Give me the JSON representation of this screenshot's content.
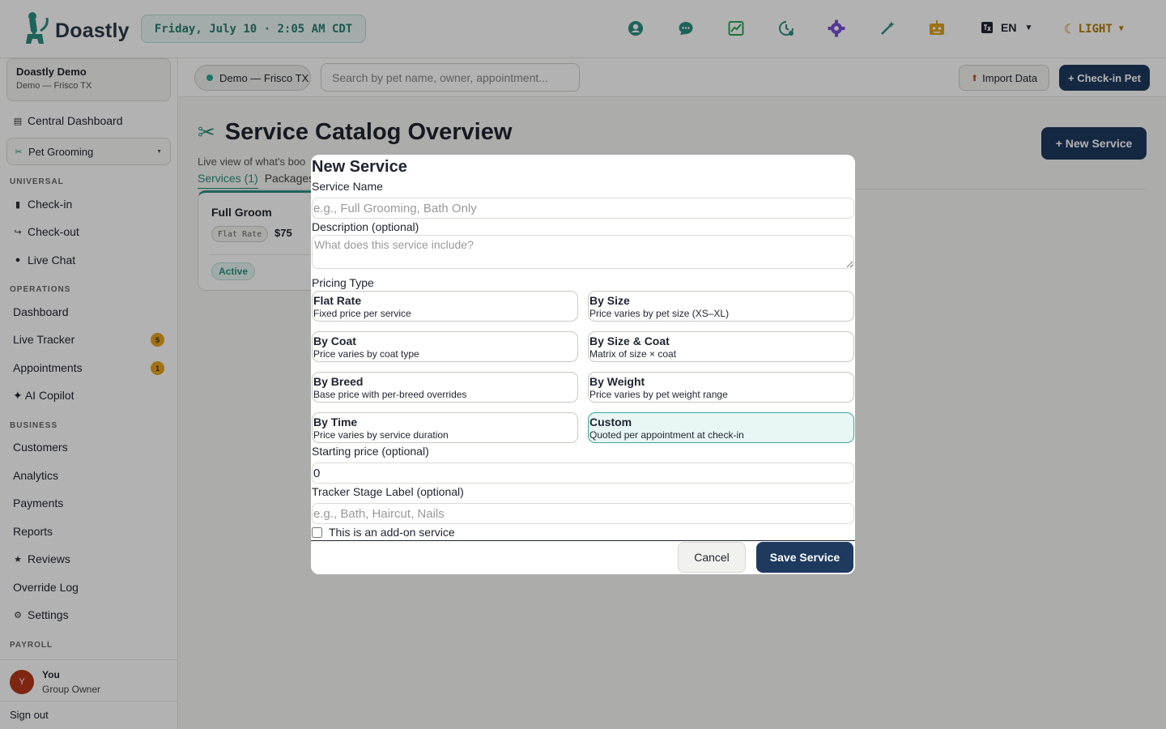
{
  "header": {
    "brand": "Doastly",
    "datetime": "Friday, July 10 · 2:05 AM CDT",
    "icons": [
      "support-icon",
      "chat-icon",
      "analytics-icon",
      "history-icon",
      "settings-icon",
      "magic-icon",
      "robot-icon"
    ],
    "language": "EN",
    "theme": "LIGHT"
  },
  "sidebar": {
    "org_name": "Doastly Demo",
    "org_location": "Demo — Frisco TX",
    "central_dashboard": "Central Dashboard",
    "module": "Pet Grooming",
    "sections": {
      "universal": "UNIVERSAL",
      "operations": "OPERATIONS",
      "business": "BUSINESS",
      "payroll": "PAYROLL"
    },
    "universal_items": [
      "Check-in",
      "Check-out",
      "Live Chat"
    ],
    "operations_items": [
      "Dashboard",
      "Live Tracker",
      "Appointments",
      "✦ AI Copilot"
    ],
    "live_tracker_count": "5",
    "appointments_count": "1",
    "business_items": [
      "Customers",
      "Analytics",
      "Payments",
      "Reports",
      "Reviews",
      "Override Log",
      "Settings"
    ],
    "user_initial": "Y",
    "user_name": "You",
    "user_role": "Group Owner",
    "sign_out": "Sign out"
  },
  "toolbar": {
    "location": "Demo — Frisco TX",
    "search_placeholder": "Search by pet name, owner, appointment...",
    "import_label": "Import Data",
    "checkin_label": "+ Check-in Pet"
  },
  "page": {
    "title": "Service Catalog Overview",
    "description": "Live view of what's boo",
    "tabs": [
      "Services (1)",
      "Packages"
    ],
    "new_service_label": "+ New Service",
    "card": {
      "name": "Full Groom",
      "pricing_tag": "Flat Rate",
      "price": "$75",
      "status": "Active"
    }
  },
  "modal": {
    "title": "New Service",
    "service_name_label": "Service Name",
    "service_name_placeholder": "e.g., Full Grooming, Bath Only",
    "description_label": "Description (optional)",
    "description_placeholder": "What does this service include?",
    "pricing_type_label": "Pricing Type",
    "pricing_types": [
      {
        "name": "Flat Rate",
        "desc": "Fixed price per service"
      },
      {
        "name": "By Size",
        "desc": "Price varies by pet size (XS–XL)"
      },
      {
        "name": "By Coat",
        "desc": "Price varies by coat type"
      },
      {
        "name": "By Size & Coat",
        "desc": "Matrix of size × coat"
      },
      {
        "name": "By Breed",
        "desc": "Base price with per-breed overrides"
      },
      {
        "name": "By Weight",
        "desc": "Price varies by pet weight range"
      },
      {
        "name": "By Time",
        "desc": "Price varies by service duration"
      },
      {
        "name": "Custom",
        "desc": "Quoted per appointment at check-in"
      }
    ],
    "selected_pricing_type": "Custom",
    "starting_price_label": "Starting price (optional)",
    "starting_price_value": "0",
    "tracker_label": "Tracker Stage Label (optional)",
    "tracker_placeholder": "e.g., Bath, Haircut, Nails",
    "addon_label": "This is an add-on service",
    "addon_checked": false,
    "cancel_label": "Cancel",
    "save_label": "Save Service"
  },
  "colors": {
    "accent": "#2c8f82",
    "primary": "#1e3a5f",
    "badge": "#e7a21c",
    "selected_bg": "#e8f7f5"
  }
}
